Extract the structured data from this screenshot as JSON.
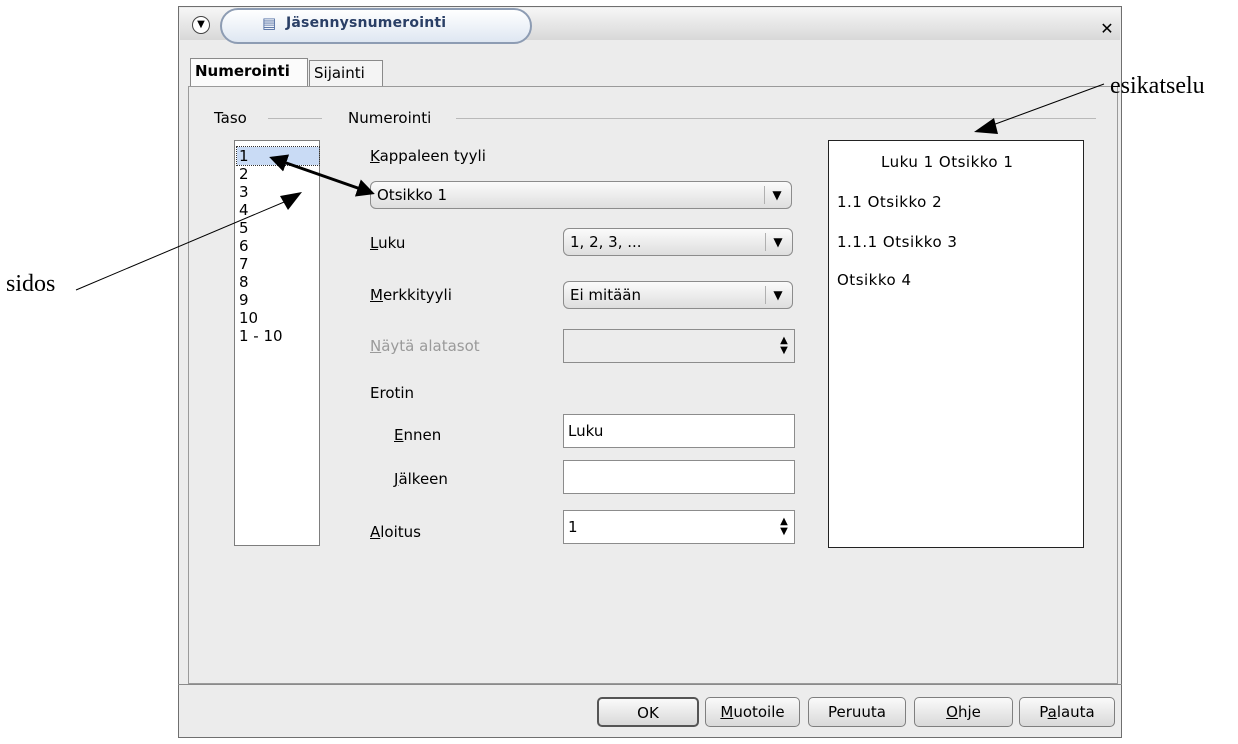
{
  "window": {
    "title": "Jäsennysnumerointi"
  },
  "tabs": [
    {
      "label": "Numerointi"
    },
    {
      "label": "Sijainti"
    }
  ],
  "taso": {
    "title": "Taso",
    "items": [
      "1",
      "2",
      "3",
      "4",
      "5",
      "6",
      "7",
      "8",
      "9",
      "10",
      "1 - 10"
    ],
    "selected": "1"
  },
  "numerointi": {
    "title": "Numerointi",
    "kappaleen_tyyli": {
      "label": "Kappaleen tyyli",
      "value": "Otsikko 1"
    },
    "luku": {
      "label": "Luku",
      "value": "1, 2, 3, ..."
    },
    "merkkityyli": {
      "label": "Merkkityyli",
      "value": "Ei mitään"
    },
    "nayta_alatasot": {
      "label": "Näytä alatasot",
      "value": ""
    },
    "erotin": {
      "label": "Erotin"
    },
    "ennen": {
      "label": "Ennen",
      "value": "Luku"
    },
    "jalkeen": {
      "label": "Jälkeen",
      "value": ""
    },
    "aloitus": {
      "label": "Aloitus",
      "value": "1"
    }
  },
  "preview": {
    "lines": [
      "Luku 1  Otsikko 1",
      "1.1  Otsikko 2",
      "1.1.1 Otsikko 3",
      "Otsikko 4"
    ]
  },
  "buttons": {
    "ok": "OK",
    "muotoile": "Muotoile",
    "peruuta": "Peruuta",
    "ohje": "Ohje",
    "palauta": "Palauta"
  },
  "annotations": {
    "sidos": "sidos",
    "esikatselu": "esikatselu"
  },
  "colors": {
    "selection": "#c9dbf5",
    "title_text": "#2a3f66"
  }
}
